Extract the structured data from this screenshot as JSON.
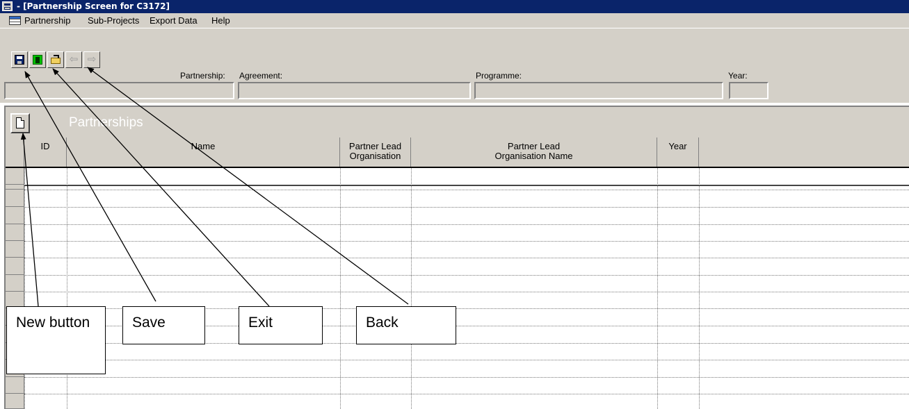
{
  "window": {
    "title": "- [Partnership Screen for C3172]"
  },
  "menu": [
    "Partnership",
    "Sub-Projects",
    "Export Data",
    "Help"
  ],
  "toolbar": {
    "buttons": [
      {
        "name": "save",
        "icon": "save-icon"
      },
      {
        "name": "exit",
        "icon": "exit-icon"
      },
      {
        "name": "back",
        "icon": "open-folder-icon"
      },
      {
        "name": "previous",
        "icon": "previous-icon",
        "disabled": true
      },
      {
        "name": "next",
        "icon": "next-icon",
        "disabled": true
      }
    ]
  },
  "header_fields": {
    "partnership_label": "Partnership:",
    "agreement_label": "Agreement:",
    "programme_label": "Programme:",
    "year_label": "Year:",
    "partnership_value": "",
    "agreement_value": "",
    "programme_value": "",
    "year_value": ""
  },
  "section": {
    "title": "Partnerships"
  },
  "grid": {
    "columns": [
      "ID",
      "Name",
      "Partner Lead\nOrganisation",
      "Partner Lead\nOrganisation Name",
      "Year",
      ""
    ],
    "rows": []
  },
  "callouts": {
    "new": "New button",
    "save": "Save",
    "exit": "Exit",
    "back": "Back"
  },
  "colors": {
    "titlebar": "#0a246a",
    "chrome": "#d4d0c8",
    "background": "#ffffff"
  }
}
